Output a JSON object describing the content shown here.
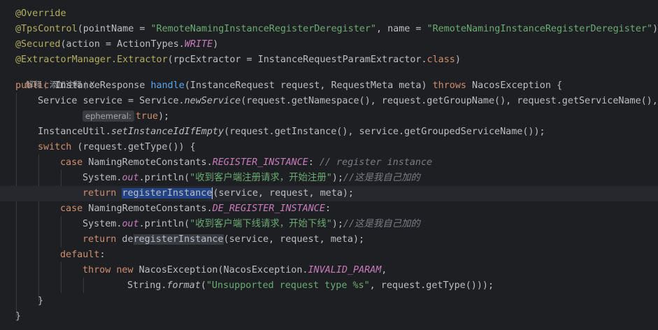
{
  "editor": {
    "code_vision": {
      "explain": "解释",
      "add_comment": "添加注释",
      "close": "X"
    },
    "inlay_hint": "ephemeral:",
    "lines": {
      "l1_ann": "@Override",
      "l2_ann": "@TpsControl",
      "l2_a": "(pointName = ",
      "l2_s1": "\"RemoteNamingInstanceRegisterDeregister\"",
      "l2_b": ", name = ",
      "l2_s2": "\"RemoteNamingInstanceRegisterDeregister\"",
      "l2_c": ")",
      "l3_ann": "@Secured",
      "l3_a": "(action = ActionTypes.",
      "l3_const": "WRITE",
      "l3_b": ")",
      "l4_ann": "@ExtractorManager.Extractor",
      "l4_a": "(rpcExtractor = InstanceRequestParamExtractor.",
      "l4_kw": "class",
      "l4_b": ")",
      "l5_kw1": "public",
      "l5_a": " InstanceResponse ",
      "l5_fn": "handle",
      "l5_b": "(InstanceRequest request, RequestMeta meta) ",
      "l5_kw2": "throws",
      "l5_c": " NacosException {",
      "l6_a": "Service service = Service.",
      "l6_stat": "newService",
      "l6_b": "(request.getNamespace(), request.getGroupName(), request.getServiceName(),",
      "l7_kw": "true",
      "l7_b": ");",
      "l8_a": "InstanceUtil.",
      "l8_stat": "setInstanceIdIfEmpty",
      "l8_b": "(request.getInstance(), service.getGroupedServiceName());",
      "l9_kw": "switch",
      "l9_a": " (request.getType()) {",
      "l10_kw": "case",
      "l10_a": " NamingRemoteConstants.",
      "l10_const": "REGISTER_INSTANCE",
      "l10_b": ": ",
      "l10_cmt": "// register instance",
      "l11_a": "System.",
      "l11_field": "out",
      "l11_b": ".println(",
      "l11_str": "\"收到客户端注册请求，开始注册\"",
      "l11_c": ");",
      "l11_cmt": "//这是我自己加的",
      "l12_kw": "return",
      "l12_sel": "registerInstance",
      "l12_b": "(service, request, meta);",
      "l13_kw": "case",
      "l13_a": " NamingRemoteConstants.",
      "l13_const": "DE_REGISTER_INSTANCE",
      "l13_b": ":",
      "l14_a": "System.",
      "l14_field": "out",
      "l14_b": ".println(",
      "l14_str": "\"收到客户端下线请求，开始下线\"",
      "l14_c": ");",
      "l14_cmt": "//这是我自己加的",
      "l15_kw": "return",
      "l15_a": " de",
      "l15_hl": "registerInstance",
      "l15_b": "(service, request, meta);",
      "l16_kw": "default",
      "l16_a": ":",
      "l17_kw1": "throw",
      "l17_kw2": "new",
      "l17_a": " NacosException(NacosException.",
      "l17_const": "INVALID_PARAM",
      "l17_b": ",",
      "l18_a": "String.",
      "l18_stat": "format",
      "l18_b": "(",
      "l18_str": "\"Unsupported request type %s\"",
      "l18_c": ", request.getType()));",
      "l19_a": "}",
      "l20_a": "}"
    },
    "colors": {
      "background": "#1e1f22",
      "annotation": "#b3ae60",
      "keyword": "#cf8e6d",
      "string": "#6aab73",
      "function": "#56a8f5",
      "constant": "#c77dbb",
      "comment": "#7a7e85",
      "selection": "#214283"
    }
  }
}
